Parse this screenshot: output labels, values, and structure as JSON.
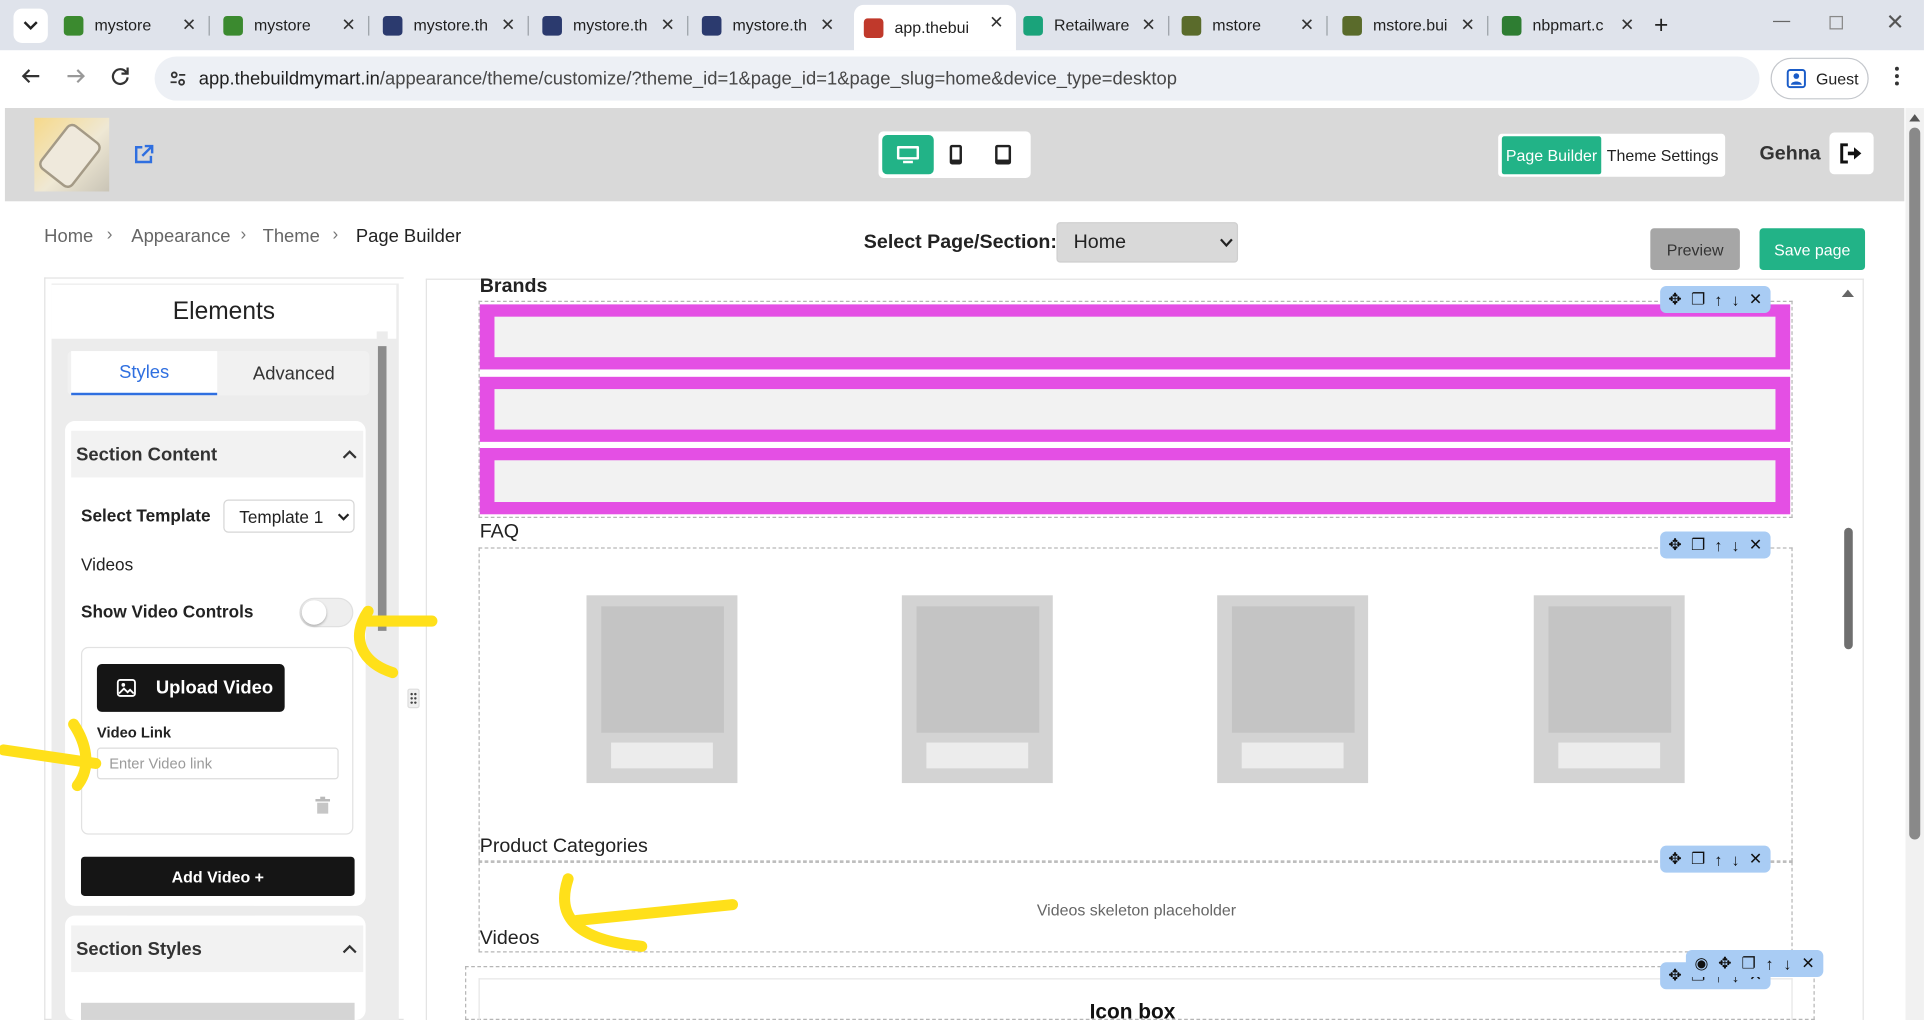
{
  "browser": {
    "tabs": [
      {
        "title": "mystore",
        "fav": "#3b8a2f"
      },
      {
        "title": "mystore",
        "fav": "#3b8a2f"
      },
      {
        "title": "mystore.th",
        "fav": "#2b3a6e"
      },
      {
        "title": "mystore.th",
        "fav": "#2b3a6e"
      },
      {
        "title": "mystore.th",
        "fav": "#2b3a6e"
      },
      {
        "title": "app.thebui",
        "fav": "#c0392b"
      },
      {
        "title": "Retailware",
        "fav": "#1aa37a"
      },
      {
        "title": "mstore",
        "fav": "#5a6b2b"
      },
      {
        "title": "mstore.bui",
        "fav": "#5a6b2b"
      },
      {
        "title": "nbpmart.c",
        "fav": "#2e7d32"
      }
    ],
    "url_domain": "app.thebuildmymart.in",
    "url_path": "/appearance/theme/customize/?theme_id=1&page_id=1&page_slug=home&device_type=desktop",
    "profile_label": "Guest"
  },
  "header": {
    "page_builder": "Page Builder",
    "theme_settings": "Theme Settings",
    "user_name": "Gehna",
    "accent": "#22b387"
  },
  "breadcrumb": {
    "home": "Home",
    "appearance": "Appearance",
    "theme": "Theme",
    "current": "Page Builder"
  },
  "page_select": {
    "label": "Select Page/Section:",
    "value": "Home"
  },
  "actions": {
    "preview": "Preview",
    "save": "Save page"
  },
  "panel": {
    "title": "Elements",
    "tab_styles": "Styles",
    "tab_advanced": "Advanced",
    "section_content": "Section Content",
    "select_template_label": "Select Template",
    "select_template_value": "Template 1",
    "videos_label": "Videos",
    "show_video_controls": "Show Video Controls",
    "upload_video": "Upload Video",
    "video_link_label": "Video Link",
    "video_link_placeholder": "Enter Video link",
    "add_video": "Add Video +",
    "section_styles": "Section Styles"
  },
  "canvas": {
    "brands_title": "Brands",
    "faq_label": "FAQ",
    "product_categories_label": "Product Categories",
    "videos_placeholder": "Videos skeleton placeholder",
    "videos_label": "Videos",
    "icon_box_title": "Icon box",
    "highlight_color": "#e44fe4",
    "annotation_color": "#ffe01a"
  }
}
